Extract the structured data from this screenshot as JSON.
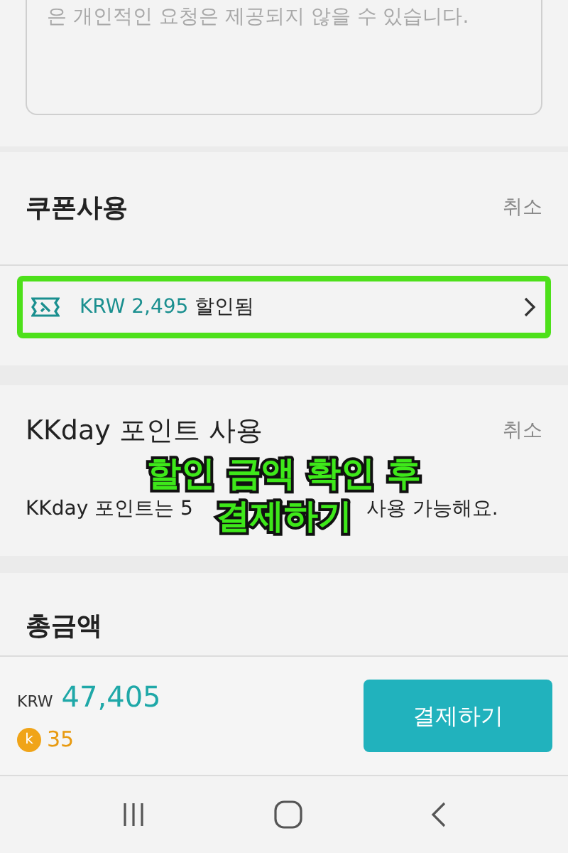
{
  "request_box": {
    "placeholder": "은 개인적인 요청은 제공되지 않을 수 있습니다."
  },
  "coupon": {
    "title": "쿠폰사용",
    "cancel": "취소",
    "amount": "KRW 2,495",
    "suffix": "할인됨",
    "highlighted": true
  },
  "points": {
    "title": "KKday 포인트 사용",
    "cancel": "취소",
    "description_parts": [
      "KKday 포인트는 5",
      "사용 가능해요."
    ]
  },
  "total": {
    "title": "총금액"
  },
  "bottom_bar": {
    "currency": "KRW",
    "amount": "47,405",
    "coin_letter": "k",
    "points": "35",
    "pay_button": "결제하기"
  },
  "annotation": {
    "lines": [
      "할인 금액 확인 후",
      "결제하기"
    ]
  }
}
